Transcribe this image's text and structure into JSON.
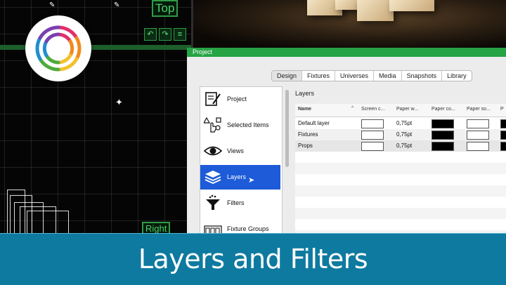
{
  "viewport": {
    "top_label": "Top",
    "right_label": "Right"
  },
  "window": {
    "title": "Project",
    "tabs": [
      {
        "label": "Design",
        "active": true
      },
      {
        "label": "Fixtures"
      },
      {
        "label": "Universes"
      },
      {
        "label": "Media"
      },
      {
        "label": "Snapshots"
      },
      {
        "label": "Library"
      }
    ]
  },
  "sidebar": {
    "items": [
      {
        "label": "Project",
        "icon": "project-icon"
      },
      {
        "label": "Selected Items",
        "icon": "selected-items-icon"
      },
      {
        "label": "Views",
        "icon": "eye-icon"
      },
      {
        "label": "Layers",
        "icon": "layers-icon",
        "active": true
      },
      {
        "label": "Filters",
        "icon": "funnel-icon"
      },
      {
        "label": "Fixture Groups",
        "icon": "fixture-groups-icon"
      }
    ]
  },
  "layers": {
    "title": "Layers",
    "columns": [
      "Name",
      "Screen c...",
      "Paper w...",
      "Paper co...",
      "Paper so...",
      "P"
    ],
    "rows": [
      {
        "name": "Default layer",
        "paper_width": "0,75pt",
        "paper_color": "#000000"
      },
      {
        "name": "Fixtures",
        "paper_width": "0,75pt",
        "paper_color": "#000000"
      },
      {
        "name": "Props",
        "paper_width": "0,75pt",
        "paper_color": "#000000"
      }
    ]
  },
  "banner": {
    "title": "Layers and Filters"
  },
  "colors": {
    "accent_green": "#26a345",
    "selection_blue": "#1d5bd8",
    "banner_blue": "#0e7aa0"
  }
}
